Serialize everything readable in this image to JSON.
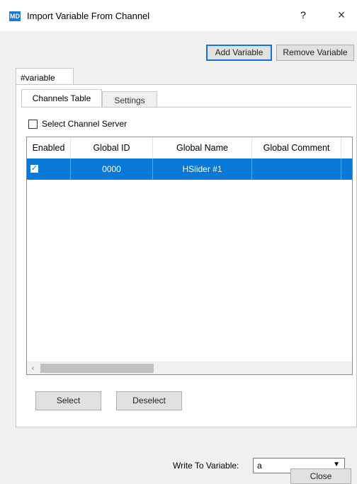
{
  "window": {
    "icon_text": "MD",
    "title": "Import Variable From Channel",
    "help_label": "?",
    "close_label": "×"
  },
  "toolbar": {
    "add_variable_label": "Add Variable",
    "remove_variable_label": "Remove Variable"
  },
  "outer_tabs": [
    {
      "label": "#variable"
    }
  ],
  "inner_tabs": [
    {
      "label": "Channels Table",
      "active": true
    },
    {
      "label": "Settings",
      "active": false
    }
  ],
  "select_server": {
    "label": "Select Channel Server",
    "checked": false
  },
  "table": {
    "columns": [
      "Enabled",
      "Global ID",
      "Global Name",
      "Global Comment"
    ],
    "rows": [
      {
        "enabled": true,
        "global_id": "0000",
        "global_name": "HSlider #1",
        "global_comment": "",
        "selected": true
      }
    ],
    "check_glyph": "✓",
    "scroll_left_glyph": "‹"
  },
  "buttons": {
    "select_label": "Select",
    "deselect_label": "Deselect",
    "close_label": "Close"
  },
  "write_to": {
    "label": "Write To Variable:",
    "value": "a",
    "arrow_glyph": "▼"
  },
  "colors": {
    "selection": "#0a78d7",
    "focus_border": "#0f73d9",
    "window_bg": "#f0f0f0"
  }
}
